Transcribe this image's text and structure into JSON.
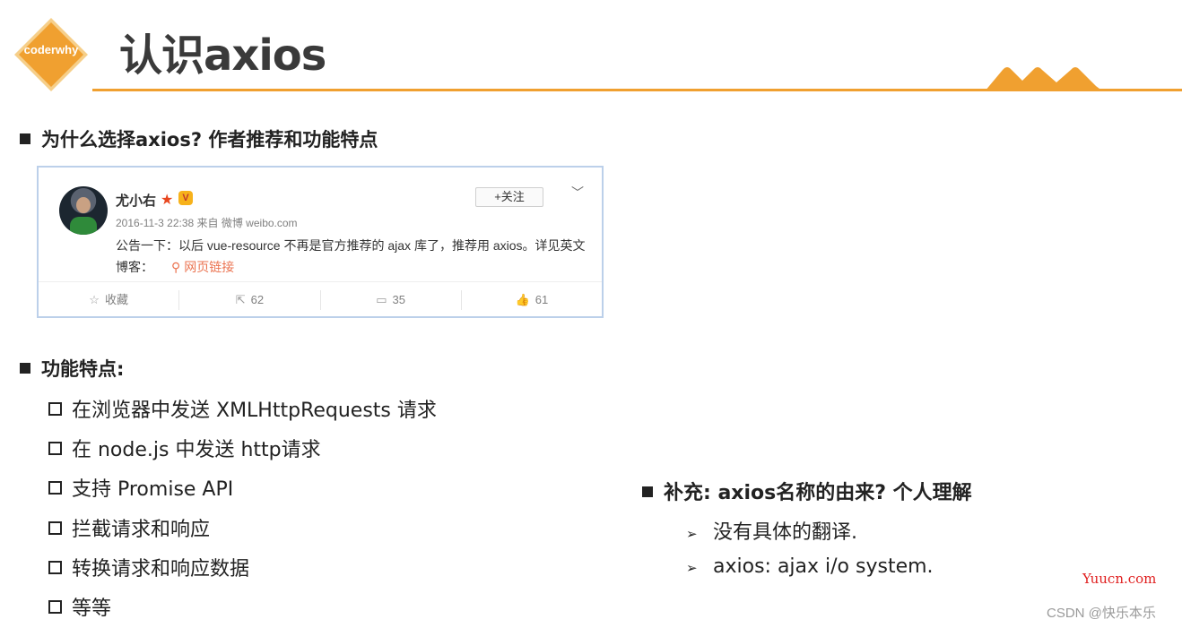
{
  "header": {
    "logo_text": "coderwhy",
    "title": "认识axios",
    "accent_color": "#f0a030"
  },
  "section1": {
    "heading": "为什么选择axios? 作者推荐和功能特点"
  },
  "weibo": {
    "username": "尤小右",
    "follow_label": "+关注",
    "meta": "2016-11-3 22:38 来自 微博 weibo.com",
    "post_text": "公告一下：以后 vue-resource 不再是官方推荐的 ajax 库了，推荐用 axios。详见英文博客：",
    "link_text": "网页链接",
    "actions": [
      {
        "icon": "star-outline-icon",
        "label": "收藏"
      },
      {
        "icon": "share-icon",
        "label": "62"
      },
      {
        "icon": "comment-icon",
        "label": "35"
      },
      {
        "icon": "thumb-up-icon",
        "label": "61"
      }
    ]
  },
  "features": {
    "heading": "功能特点:",
    "items": [
      "在浏览器中发送 XMLHttpRequests 请求",
      "在 node.js 中发送 http请求",
      "支持 Promise API",
      "拦截请求和响应",
      "转换请求和响应数据",
      "等等"
    ]
  },
  "supplement": {
    "heading": "补充: axios名称的由来? 个人理解",
    "items": [
      "没有具体的翻译.",
      "axios: ajax i/o system."
    ]
  },
  "watermarks": {
    "yuucn": "Yuucn.com",
    "csdn": "CSDN @快乐本乐"
  }
}
